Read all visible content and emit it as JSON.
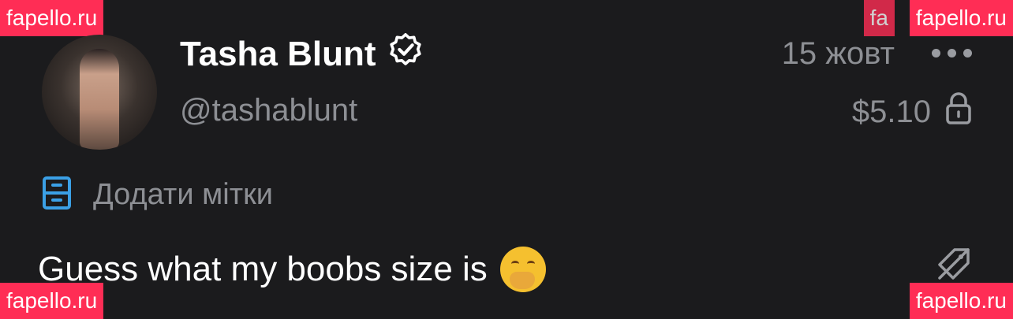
{
  "watermarks": {
    "top_left": "fapello.ru",
    "top_right": "fapello.ru",
    "top_right_ghost": "fa",
    "bottom_left": "fapello.ru",
    "bottom_right": "fapello.ru"
  },
  "post": {
    "author_name": "Tasha Blunt",
    "author_handle": "@tashablunt",
    "date": "15 жовт",
    "price": "$5.10",
    "tags_label": "Додати мітки",
    "text": "Guess what my boobs size is",
    "emoji": "face with hand over mouth"
  },
  "icons": {
    "verified": "verified-badge-icon",
    "more": "more-dots-icon",
    "lock": "lock-icon",
    "tags": "tags-icon",
    "tag_off": "tag-off-icon"
  },
  "colors": {
    "background": "#1b1b1d",
    "muted_text": "#8d8f94",
    "accent_blue": "#3ba0e6",
    "watermark": "#ff2d55"
  }
}
